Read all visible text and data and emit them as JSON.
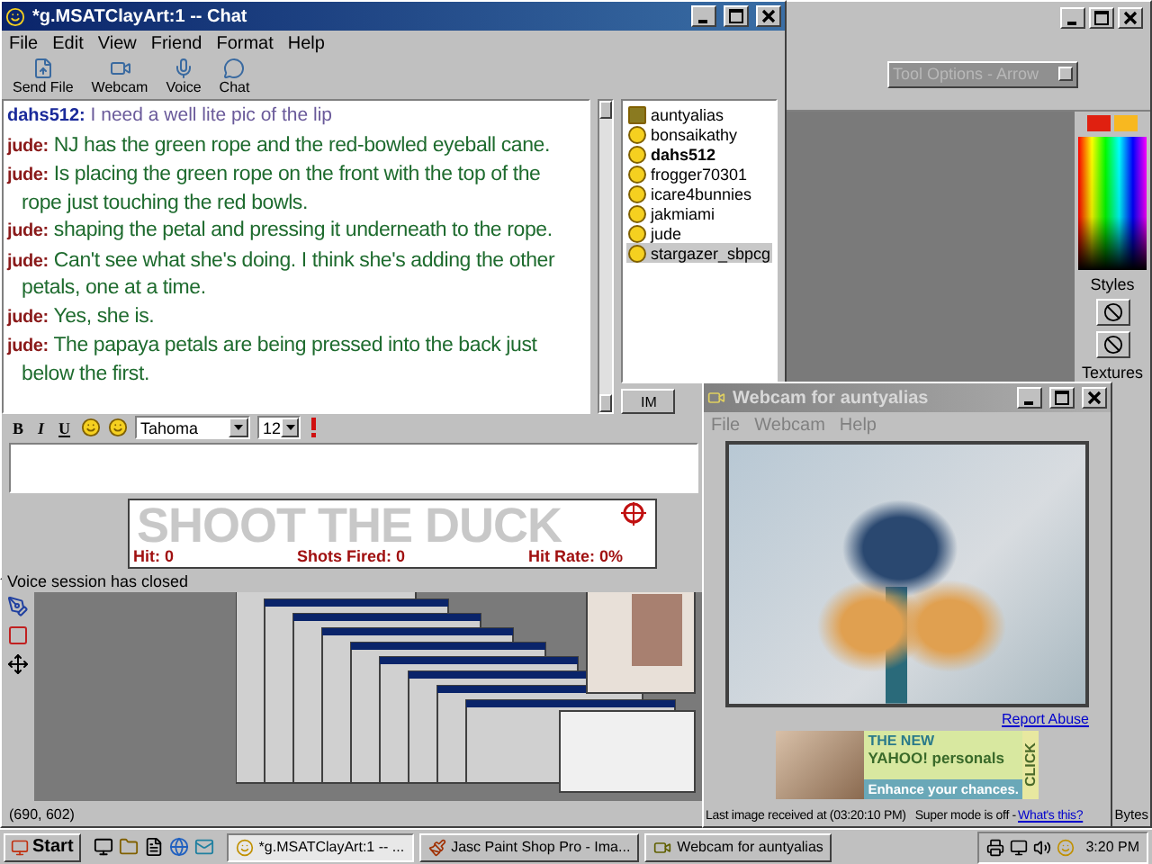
{
  "paint_shop": {
    "tool_options_title": "Tool Options - Arrow",
    "palette_labels": [
      "Styles",
      "Textures"
    ],
    "coordinates": "(690, 602)",
    "bytes": "Bytes"
  },
  "chat_window": {
    "title": "*g.MSATClayArt:1 -- Chat",
    "menu": [
      "File",
      "Edit",
      "View",
      "Friend",
      "Format",
      "Help"
    ],
    "toolbar": [
      "Send File",
      "Webcam",
      "Voice",
      "Chat"
    ],
    "messages": [
      {
        "sender": "dahs512:",
        "text": "I need a well lite pic of the lip",
        "kind": "plain"
      },
      {
        "sender": "jude:",
        "text": "NJ has the green rope and the red-bowled eyeball cane.",
        "kind": "styled"
      },
      {
        "sender": "jude:",
        "text": "Is placing the green rope on the front with the top of the rope just touching the red bowls.",
        "kind": "styled"
      },
      {
        "sender": "jude:",
        "text": "shaping the petal and pressing it underneath to the rope.",
        "kind": "styled"
      },
      {
        "sender": "jude:",
        "text": "Can't see what she's doing. I think she's adding the other petals, one at a time.",
        "kind": "styled"
      },
      {
        "sender": "jude:",
        "text": "Yes, she is.",
        "kind": "styled"
      },
      {
        "sender": "jude:",
        "text": "The papaya petals are being pressed into the back just below the first.",
        "kind": "styled"
      }
    ],
    "users": [
      {
        "name": "auntyalias",
        "kind": "webcam",
        "bold": false,
        "selected": false
      },
      {
        "name": "bonsaikathy",
        "kind": "online",
        "bold": false,
        "selected": false
      },
      {
        "name": "dahs512",
        "kind": "online",
        "bold": true,
        "selected": false
      },
      {
        "name": "frogger70301",
        "kind": "online",
        "bold": false,
        "selected": false
      },
      {
        "name": "icare4bunnies",
        "kind": "online",
        "bold": false,
        "selected": false
      },
      {
        "name": "jakmiami",
        "kind": "online",
        "bold": false,
        "selected": false
      },
      {
        "name": "jude",
        "kind": "online",
        "bold": false,
        "selected": false
      },
      {
        "name": "stargazer_sbpcg",
        "kind": "online",
        "bold": false,
        "selected": true
      }
    ],
    "im_button": "IM",
    "format_bar": {
      "bold": "B",
      "italic": "I",
      "underline": "U",
      "font": "Tahoma",
      "size": "12"
    },
    "game_banner": {
      "title": "SHOOT THE DUCK",
      "stats": [
        "Hit: 0",
        "Shots Fired: 0",
        "Hit Rate: 0%"
      ]
    },
    "status": "Voice session has closed"
  },
  "webcam_window": {
    "title": "Webcam for auntyalias",
    "menu": [
      "File",
      "Webcam",
      "Help"
    ],
    "report_link": "Report Abuse",
    "ad": {
      "headline": "THE NEW",
      "brand": "YAHOO! personals",
      "tagline": "Enhance your chances.",
      "click": "CLICK"
    },
    "last_image": "Last image received at (03:20:10 PM)",
    "super_mode": "Super mode is off - ",
    "whats_this": "What's this?"
  },
  "taskbar": {
    "start": "Start",
    "tasks": [
      {
        "label": "*g.MSATClayArt:1 -- ...",
        "kind": "chat",
        "selected": true
      },
      {
        "label": "Jasc Paint Shop Pro - Ima...",
        "kind": "paint",
        "selected": false
      },
      {
        "label": "Webcam for auntyalias",
        "kind": "webcam",
        "selected": false
      }
    ],
    "clock": "3:20 PM"
  }
}
